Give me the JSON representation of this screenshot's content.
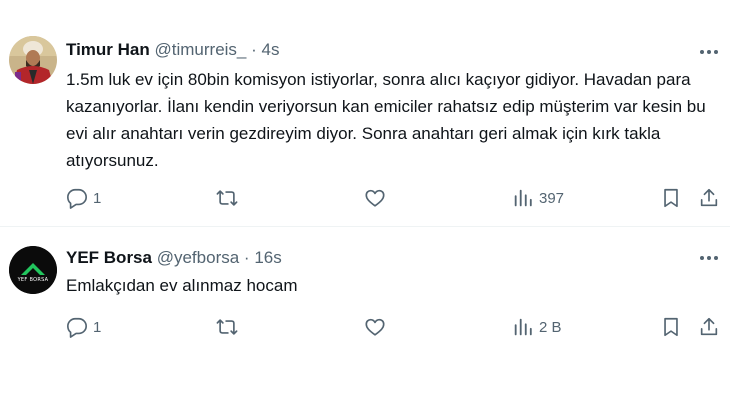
{
  "tweets": [
    {
      "name": "Timur Han",
      "handle": "@timurreis_",
      "separator": "·",
      "time": "4s",
      "text": "1.5m luk ev için 80bin komisyon istiyorlar, sonra alıcı kaçıyor gidiyor. Havadan para kazanıyorlar. İlanı kendin veriyorsun kan emiciler rahatsız edip müşterim var kesin bu evi alır anahtarı verin gezdireyim diyor. Sonra anahtarı geri almak için kırk takla atıyorsunuz.",
      "avatar_icon": "portrait-avatar",
      "replies": "1",
      "reposts": "",
      "likes": "",
      "views": "397"
    },
    {
      "name": "YEF Borsa",
      "handle": "@yefborsa",
      "separator": "·",
      "time": "16s",
      "text": "Emlakçıdan ev alınmaz hocam",
      "avatar_icon": "yef-borsa-logo",
      "avatar_label": "YEF BORSA",
      "replies": "1",
      "reposts": "",
      "likes": "",
      "views": "2 B"
    }
  ],
  "colors": {
    "text": "#0f1419",
    "muted": "#536471",
    "logo_green": "#22c55e",
    "logo_bg": "#0b0b0b"
  }
}
